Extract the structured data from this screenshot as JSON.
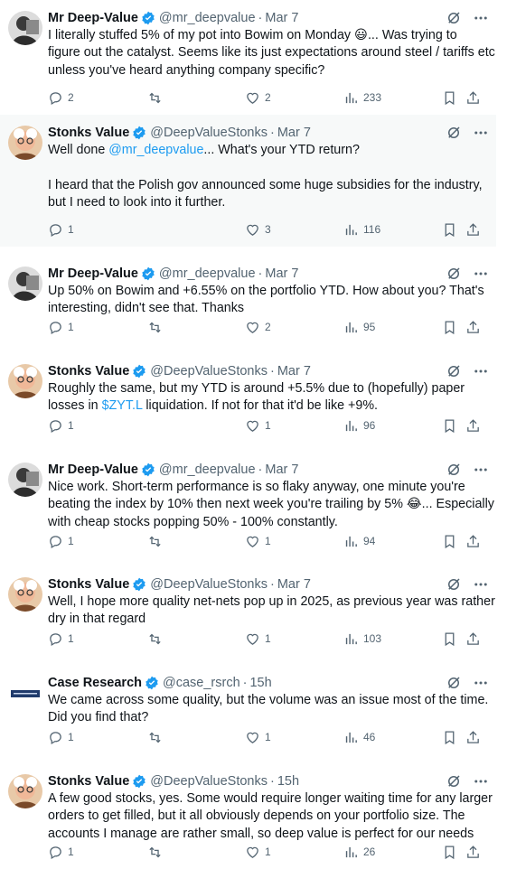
{
  "tweets": [
    {
      "name": "Mr Deep-Value",
      "handle": "@mr_deepvalue",
      "time": "Mar 7",
      "lines": [
        "I literally stuffed 5% of my pot into Bowim on Monday 😃... Was trying to",
        "figure out the catalyst. Seems like its just expectations around steel / tariffs etc",
        "unless you've heard anything company specific?"
      ],
      "replies": "2",
      "retweets": "",
      "likes": "2",
      "views": "233"
    },
    {
      "name": "Stonks Value",
      "handle": "@DeepValueStonks",
      "time": "Mar 7",
      "lines": [
        "Well done @mr_deepvalue... What's your YTD return?",
        "",
        "I heard that the Polish gov announced some huge subsidies for the industry,",
        "but I need to look into it further."
      ],
      "replies": "1",
      "retweets": "",
      "likes": "3",
      "views": "116"
    },
    {
      "name": "Mr Deep-Value",
      "handle": "@mr_deepvalue",
      "time": "Mar 7",
      "lines": [
        "Up 50% on Bowim and +6.55% on the portfolio YTD. How about you? That's",
        "interesting, didn't see that. Thanks"
      ],
      "replies": "1",
      "retweets": "",
      "likes": "2",
      "views": "95"
    },
    {
      "name": "Stonks Value",
      "handle": "@DeepValueStonks",
      "time": "Mar 7",
      "lines": [
        "Roughly the same, but my YTD is around +5.5% due to (hopefully) paper",
        "losses in $ZYT.L liquidation. If not for that it'd be like +9%."
      ],
      "replies": "1",
      "retweets": "",
      "likes": "1",
      "views": "96"
    },
    {
      "name": "Mr Deep-Value",
      "handle": "@mr_deepvalue",
      "time": "Mar 7",
      "lines": [
        "Nice work. Short-term performance is so flaky anyway, one minute you're",
        "beating the index by 10% then next week you're trailing by 5% 😂... Especially",
        "with cheap stocks popping 50% - 100% constantly."
      ],
      "replies": "1",
      "retweets": "",
      "likes": "1",
      "views": "94"
    },
    {
      "name": "Stonks Value",
      "handle": "@DeepValueStonks",
      "time": "Mar 7",
      "lines": [
        "Well, I hope more quality net-nets pop up in 2025, as previous year was rather",
        "dry in that regard"
      ],
      "replies": "1",
      "retweets": "",
      "likes": "1",
      "views": "103"
    },
    {
      "name": "Case Research",
      "handle": "@case_rsrch",
      "time": "15h",
      "lines": [
        "We came across some quality, but the volume was an issue most of the time.",
        "Did you find that?"
      ],
      "replies": "1",
      "retweets": "",
      "likes": "1",
      "views": "46"
    },
    {
      "name": "Stonks Value",
      "handle": "@DeepValueStonks",
      "time": "15h",
      "lines": [
        "A few good stocks, yes. Some would require longer waiting time for any larger",
        "orders to get filled, but it all obviously depends on your portfolio size. The",
        "accounts I manage are rather small, so deep value is perfect for our needs"
      ],
      "replies": "1",
      "retweets": "",
      "likes": "1",
      "views": "26"
    }
  ],
  "separator": "·",
  "mention": "@mr_deepvalue",
  "cashtag": "$ZYT.L",
  "colors": {
    "accent": "#1d9bf0",
    "secondary_text": "#536471",
    "highlight_bg": "#f7f9f9"
  },
  "icons": {
    "verified": "verified-badge-icon",
    "grok": "grok-icon",
    "more": "more-icon",
    "reply": "reply-icon",
    "retweet": "retweet-icon",
    "like": "heart-icon",
    "views": "views-icon",
    "bookmark": "bookmark-icon",
    "share": "share-icon"
  }
}
